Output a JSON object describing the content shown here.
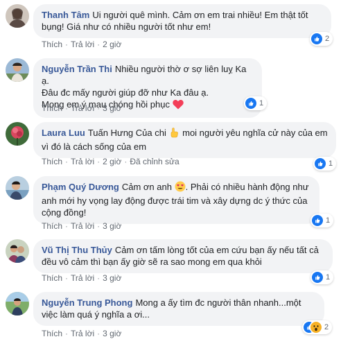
{
  "comments": [
    {
      "author": "Thanh Tâm",
      "text": "Ui người quê mình. Cảm ơn em trai nhiều! Em thật tốt bụng! Giá như có nhiều người tốt như em!",
      "actions": {
        "like": "Thích",
        "reply": "Trả lời",
        "time": "2 giờ"
      },
      "reaction_count": "2"
    },
    {
      "author": "Nguyễn Trần Thi",
      "text_lines": [
        "Nhiều người thờ ơ sợ liên luỵ Ka ạ.",
        "Đâu đc mấy người giúp đỡ như Ka đâu ạ.",
        "Mong em ý mau chóng hồi phục"
      ],
      "emoji": "heart-icon",
      "actions": {
        "like": "Thích",
        "reply": "Trả lời",
        "time": "3 giờ"
      },
      "reaction_count": "1"
    },
    {
      "author": "Laura Luu",
      "text_a": "Tuấn Hưng Của chi",
      "emoji": "pointing-hand-icon",
      "text_b": "moi người yêu nghĩa cử này của em vì đó là cách sống của em",
      "actions": {
        "like": "Thích",
        "reply": "Trả lời",
        "time": "2 giờ",
        "edited": "Đã chỉnh sửa"
      },
      "reaction_count": "1"
    },
    {
      "author": "Phạm Quý Dương",
      "text_a": "Cảm ơn anh",
      "emoji": "heart-eyes-icon",
      "text_b": ". Phải có nhiều hành động như anh mới hy vọng lay động được trái tim và xây dựng dc ý thức của cộng đồng!",
      "actions": {
        "like": "Thích",
        "reply": "Trả lời",
        "time": "3 giờ"
      },
      "reaction_count": "1"
    },
    {
      "author": "Vũ Thị Thu Thủy",
      "text": "Cảm ơn tấm lòng tốt của em cứu bạn ấy nếu tất cả đều vô cảm thì bạn ấy giờ sẽ ra sao mong em qua khỏi",
      "actions": {
        "like": "Thích",
        "reply": "Trả lời",
        "time": "3 giờ"
      },
      "reaction_count": "1"
    },
    {
      "author": "Nguyễn Trung Phong",
      "text": "Mong a ấy tìm đc người thân nhanh...một việc làm quá ý nghĩa a ơi...",
      "actions": {
        "like": "Thích",
        "reply": "Trả lời",
        "time": "3 giờ"
      },
      "reaction_count": "2"
    }
  ],
  "colors": {
    "author": "#385898",
    "bubble": "#f2f3f5",
    "like": "#1877f2",
    "wow": "#f7b125",
    "heart": "#f33e58"
  }
}
